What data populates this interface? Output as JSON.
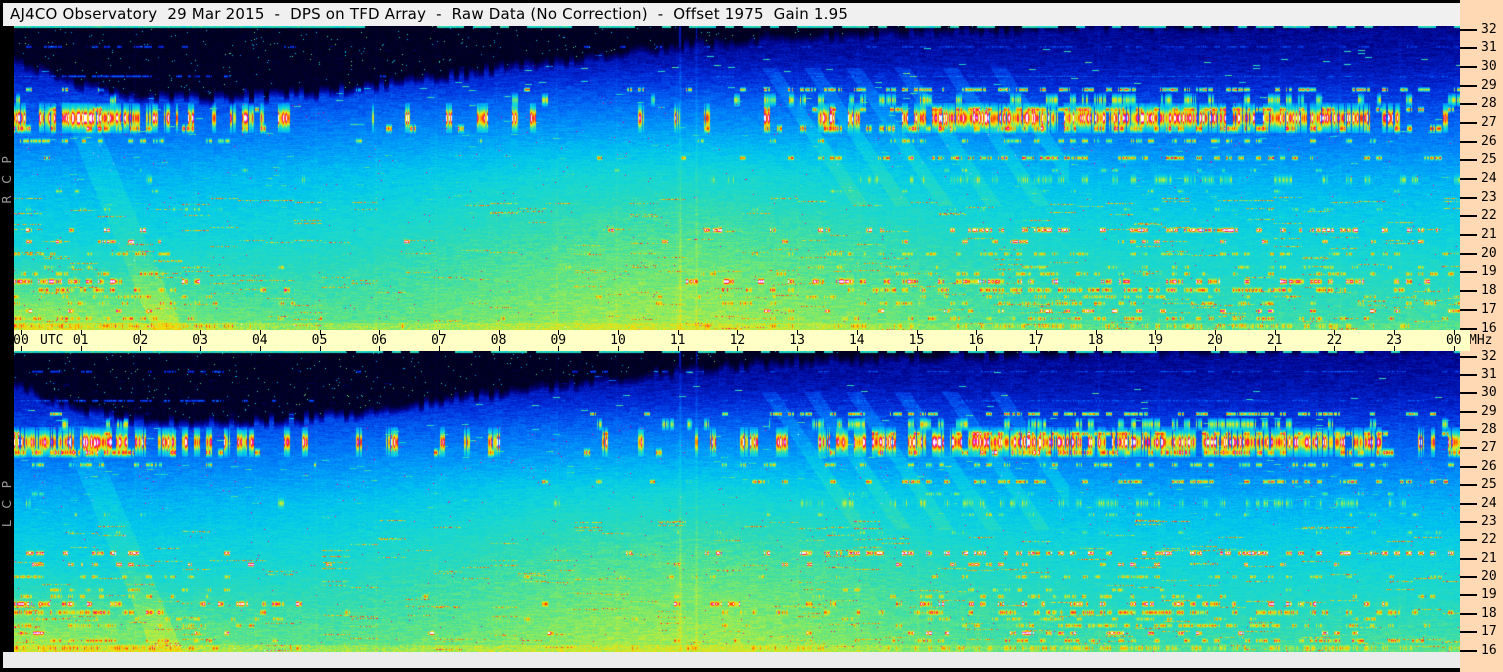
{
  "window": {
    "title": "AJ4CO Observatory  29 Mar 2015  -  DPS on TFD Array  -  Raw Data (No Correction)  -  Offset 1975  Gain 1.95"
  },
  "panels": [
    {
      "name": "RCP",
      "axis_label": "R C P",
      "description": "Right circular polarization dynamic spectrum, 16-32 MHz over 24 h UTC"
    },
    {
      "name": "LCP",
      "axis_label": "L C P",
      "description": "Left circular polarization dynamic spectrum, 16-32 MHz over 24 h UTC"
    }
  ],
  "time_axis": {
    "utc_label": "UTC",
    "hour_labels": [
      "00",
      "01",
      "02",
      "03",
      "04",
      "05",
      "06",
      "07",
      "08",
      "09",
      "10",
      "11",
      "12",
      "13",
      "14",
      "15",
      "16",
      "17",
      "18",
      "19",
      "20",
      "21",
      "22",
      "23",
      "00"
    ]
  },
  "freq_axis": {
    "unit": "MHz",
    "ticks": [
      32,
      31,
      30,
      29,
      28,
      27,
      26,
      25,
      24,
      23,
      22,
      21,
      20,
      19,
      18,
      17,
      16
    ]
  },
  "colors": {
    "titlebar_bg": "#f0f0f0",
    "time_axis_bg": "#ffffc6",
    "freq_axis_bg": "#ffd9b3",
    "frame": "#000000",
    "panel_label_gray": "#9a9a9a"
  },
  "chart_data": {
    "type": "heatmap",
    "title": "AJ4CO Observatory 29 Mar 2015 - DPS on TFD Array - Raw Data (No Correction) - Offset 1975 Gain 1.95",
    "date": "29 Mar 2015",
    "instrument": "DPS on TFD Array",
    "processing": "Raw Data (No Correction)",
    "offset": 1975,
    "gain": 1.95,
    "panels": [
      {
        "series": "RCP",
        "position": "top"
      },
      {
        "series": "LCP",
        "position": "bottom"
      }
    ],
    "x": {
      "label": "UTC",
      "unit": "hours",
      "range": [
        0,
        24
      ],
      "tick_interval": 1
    },
    "y": {
      "label": "frequency",
      "unit": "MHz",
      "range": [
        16,
        32
      ],
      "tick_interval": 1
    },
    "colormap": "jet-like: no signal -> black/dark blue, background -> blue/cyan/turquoise, strong RFI -> green/yellow/orange/red/magenta/white",
    "legend_position": "none",
    "grid": false,
    "features": [
      "ionospheric cutoff: black (no-signal) region at top of band, extending down to ~28 MHz between 00-06 UTC, rising above ~31.5 MHz after 13 UTC; same in both panels",
      "strong HF/CB interference band near 26.5-28.5 MHz, intense 00-05 UTC and 12-24 UTC, nearly absent 06-11 UTC",
      "thin yellow carrier near 28.6 MHz on right half; orange carrier near 25 MHz 11-24 UTC",
      "magenta/purple dashed carriers near 21.2 and 20.6 MHz with white bursts",
      "dense narrowband RFI dashes (yellow/orange/red/magenta) throughout 16-19.5 MHz, strongest 00-06 and 12-24 UTC",
      "bright turquoise/cyan galactic background enhancement across 16-27 MHz centered ~08-14 UTC",
      "green enhancement below ~20 MHz near 00-06 UTC and in lower-right corner",
      "faint bright vertical line near 11.2 UTC spanning full band in both panels",
      "bright teal line along the top edge (32 MHz) of each panel"
    ]
  }
}
